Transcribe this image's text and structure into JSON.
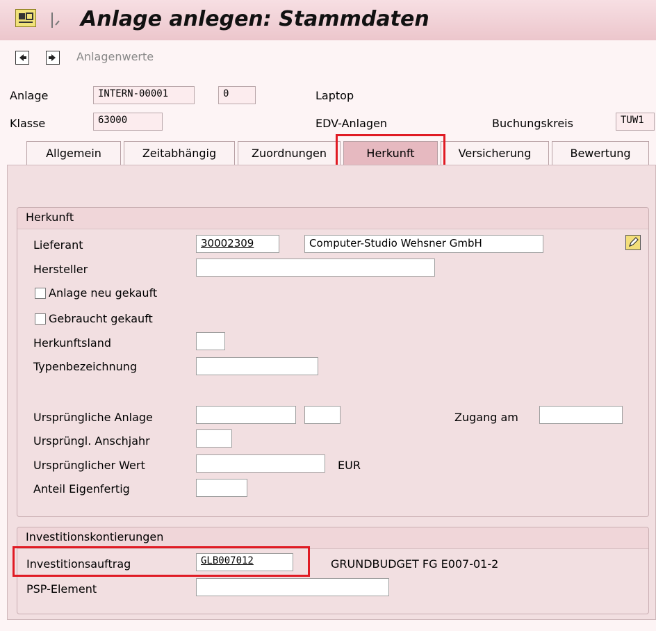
{
  "title": "Anlage anlegen:  Stammdaten",
  "toolbar": {
    "icons": [
      "previous-record-icon",
      "next-record-icon"
    ],
    "label": "Anlagenwerte"
  },
  "header": {
    "anlage_label": "Anlage",
    "anlage_value": "INTERN-00001",
    "anlage_sub": "0",
    "anlage_text": "Laptop",
    "klasse_label": "Klasse",
    "klasse_value": "63000",
    "klasse_text": "EDV-Anlagen",
    "buchungskreis_label": "Buchungskreis",
    "buchungskreis_value": "TUW1"
  },
  "tabs": [
    {
      "label": "Allgemein"
    },
    {
      "label": "Zeitabhängig"
    },
    {
      "label": "Zuordnungen"
    },
    {
      "label": "Herkunft"
    },
    {
      "label": "Versicherung"
    },
    {
      "label": "Bewertung"
    }
  ],
  "active_tab": "Herkunft",
  "herkunft": {
    "title": "Herkunft",
    "lieferant_label": "Lieferant",
    "lieferant_value": "30002309",
    "lieferant_name": "Computer-Studio Wehsner GmbH",
    "hersteller_label": "Hersteller",
    "hersteller_value": "",
    "neu_gekauft_label": "Anlage neu gekauft",
    "gebraucht_label": "Gebraucht gekauft",
    "herkunftsland_label": "Herkunftsland",
    "herkunftsland_value": "",
    "typenbezeichnung_label": "Typenbezeichnung",
    "typenbezeichnung_value": "",
    "urspr_anlage_label": "Ursprüngliche Anlage",
    "urspr_anlage_value": "",
    "urspr_anlage_sub": "",
    "zugang_label": "Zugang am",
    "zugang_value": "",
    "urspr_jahr_label": "Ursprüngl. Anschjahr",
    "urspr_jahr_value": "",
    "urspr_wert_label": "Ursprünglicher Wert",
    "urspr_wert_value": "",
    "currency": "EUR",
    "eigenfertig_label": "Anteil Eigenfertig",
    "eigenfertig_value": ""
  },
  "invest": {
    "title": "Investitionskontierungen",
    "auftrag_label": "Investitionsauftrag",
    "auftrag_value": "GLB007012",
    "auftrag_text": "GRUNDBUDGET FG E007-01-2",
    "psp_label": "PSP-Element",
    "psp_value": ""
  },
  "colors": {
    "highlight": "#e01b24",
    "panel": "#f2dfe1",
    "active_tab": "#e6b9c0"
  }
}
